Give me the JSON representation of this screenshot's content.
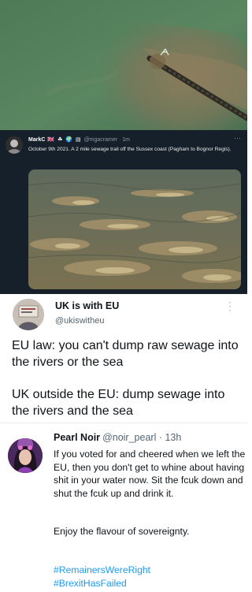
{
  "dark_tweet": {
    "name": "MarkC",
    "emoji": "🇬🇧 ☘ 🌍 ▤",
    "handle": "@mgacramer · 1m",
    "more": "···",
    "text": "October 9th 2021. A 2 mile sewage trail off the Sussex coast (Pagham to Bognor Regis)."
  },
  "tweet1": {
    "name": "UK is with EU",
    "handle": "@ukiswitheu",
    "para1": "EU law: you can't dump raw sewage into the rivers or the sea",
    "para2": "UK outside the EU: dump sewage into the rivers and the sea"
  },
  "tweet2": {
    "name": "Pearl Noir",
    "handle": "@noir_pearl · 13h",
    "para1": "If you voted for and cheered when we left the EU, then you don't get to whine about having shit in your water now. Sit the fcuk down and shut the fcuk up and drink it.",
    "para2": "Enjoy the flavour of sovereignty.",
    "hashtag1": "#RemainersWereRight",
    "hashtag2": "#BrexitHasFailed"
  },
  "colors": {
    "dark_bg": "#15202b",
    "hashtag": "#1d9bf0",
    "sea_green": "#4f7d58",
    "sewage_brown": "#8a7a5a"
  }
}
